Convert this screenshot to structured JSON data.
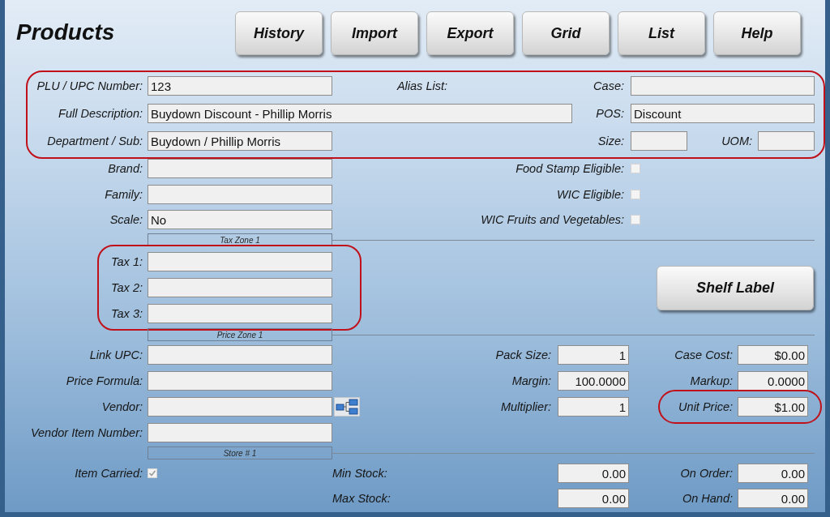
{
  "window": {
    "title": "Products"
  },
  "toolbar": [
    "History",
    "Import",
    "Export",
    "Grid",
    "List",
    "Help"
  ],
  "item_section": {
    "highlighted": true,
    "plu_upc_number": {
      "label": "PLU / UPC Number:",
      "value": "123"
    },
    "alias_list": {
      "label": "Alias List:"
    },
    "case": {
      "label": "Case:"
    },
    "full_description": {
      "label": "Full Description:",
      "value": "Buydown Discount - Phillip Morris"
    },
    "pos": {
      "label": "POS:",
      "value": "Discount"
    },
    "department_sub": {
      "label": "Department / Sub:",
      "value": "Buydown / Phillip Morris"
    },
    "size": {
      "label": "Size:"
    },
    "uom": {
      "label": "UOM:"
    }
  },
  "details": [
    {
      "label": "Brand:"
    },
    {
      "label": "Family:"
    },
    {
      "label": "Scale:",
      "value": "No"
    }
  ],
  "eligibility": [
    {
      "label": "Food Stamp Eligible:",
      "checked": false
    },
    {
      "label": "WIC Eligible:",
      "checked": false
    },
    {
      "label": "WIC Fruits and Vegetables:",
      "checked": false
    }
  ],
  "tax_zone": {
    "title": "Tax Zone 1",
    "highlighted": true,
    "taxes": [
      {
        "label": "Tax 1:"
      },
      {
        "label": "Tax 2:"
      },
      {
        "label": "Tax 3:"
      }
    ]
  },
  "shelf_label_button": "Shelf Label",
  "price_zone": {
    "title": "Price Zone 1",
    "fields": [
      {
        "label": "Link UPC:"
      },
      {
        "label": "Price Formula:"
      },
      {
        "label": "Vendor:"
      },
      {
        "label": "Vendor Item Number:"
      }
    ],
    "pricing": [
      {
        "label": "Pack Size:",
        "value": "1",
        "highlighted": false
      },
      {
        "label": "Case Cost:",
        "value": "$0.00",
        "highlighted": false
      },
      {
        "label": "Margin:",
        "value": "100.0000",
        "highlighted": false
      },
      {
        "label": "Markup:",
        "value": "0.0000",
        "highlighted": false
      },
      {
        "label": "Multiplier:",
        "value": "1",
        "highlighted": false
      },
      {
        "label": "Unit Price:",
        "value": "$1.00",
        "highlighted": true
      }
    ]
  },
  "store": {
    "title": "Store # 1",
    "item_carried": {
      "label": "Item Carried:",
      "checked": true
    },
    "stock": [
      {
        "label": "Min Stock:",
        "value": "0.00"
      },
      {
        "label": "On Order:",
        "value": "0.00"
      },
      {
        "label": "Max Stock:",
        "value": "0.00"
      },
      {
        "label": "On Hand:",
        "value": "0.00"
      }
    ]
  }
}
